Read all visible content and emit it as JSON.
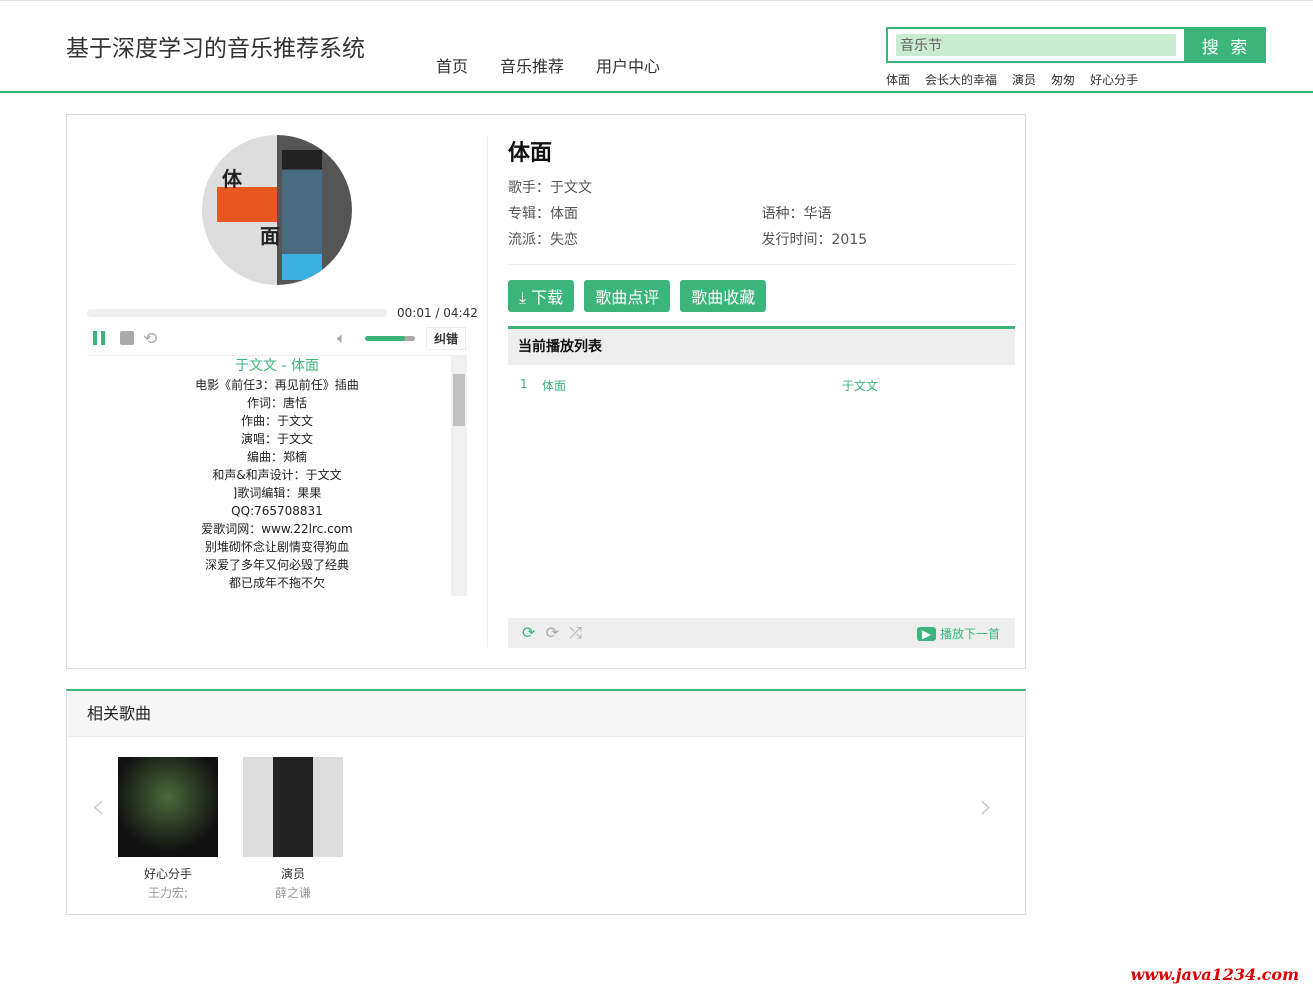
{
  "header": {
    "title": "基于深度学习的音乐推荐系统",
    "nav": [
      "首页",
      "音乐推荐",
      "用户中心"
    ],
    "search_value": "音乐节",
    "search_button": "搜 索",
    "hot": [
      "体面",
      "会长大的幸福",
      "演员",
      "匆匆",
      "好心分手"
    ]
  },
  "player": {
    "time": "00:01 / 04:42",
    "progress": 0.004,
    "volume": 0.8,
    "error_button": "纠错",
    "lyrics_title": "于文文 - 体面",
    "lyrics": [
      "电影《前任3：再见前任》插曲",
      "作词：唐恬",
      "作曲：于文文",
      "演唱：于文文",
      "编曲：郑楠",
      "和声&和声设计：于文文",
      "]歌词编辑：果果",
      "QQ:765708831",
      "爱歌词网：www.22lrc.com",
      "别堆砌怀念让剧情变得狗血",
      "深爱了多年又何必毁了经典",
      "都已成年不拖不欠"
    ]
  },
  "song": {
    "title": "体面",
    "singer": "歌手：于文文",
    "album": "专辑：体面",
    "language": "语种：华语",
    "genre": "流派：失恋",
    "release": "发行时间：2015"
  },
  "actions": {
    "download": "下载",
    "comment": "歌曲点评",
    "favorite": "歌曲收藏"
  },
  "playlist": {
    "title": "当前播放列表",
    "items": [
      {
        "no": "1",
        "name": "体面",
        "artist": "于文文"
      }
    ],
    "next": "播放下一首"
  },
  "related": {
    "title": "相关歌曲",
    "items": [
      {
        "name": "好心分手",
        "artist": "王力宏;"
      },
      {
        "name": "演员",
        "artist": "薛之谦"
      }
    ]
  },
  "watermark": "www.java1234.com",
  "colors": {
    "accent": "#3cb57b"
  }
}
